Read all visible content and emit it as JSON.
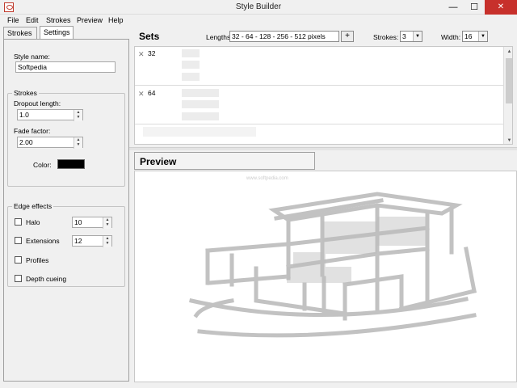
{
  "window": {
    "title": "Style Builder",
    "minimize": "—",
    "maximize": "☐",
    "close": "✕"
  },
  "menu": [
    "File",
    "Edit",
    "Strokes",
    "Preview",
    "Help"
  ],
  "tabs": {
    "strokes": "Strokes",
    "settings": "Settings"
  },
  "style_name": {
    "label": "Style name:",
    "value": "Softpedia"
  },
  "strokes_group": {
    "title": "Strokes",
    "dropout_label": "Dropout length:",
    "dropout_value": "1.0",
    "fade_label": "Fade factor:",
    "fade_value": "2.00",
    "color_label": "Color:",
    "color_value": "#000000"
  },
  "edge_effects": {
    "title": "Edge effects",
    "halo_label": "Halo",
    "halo_value": "10",
    "extensions_label": "Extensions",
    "extensions_value": "12",
    "profiles_label": "Profiles",
    "depth_label": "Depth cueing"
  },
  "sets": {
    "title": "Sets",
    "lengths_label": "Lengths:",
    "lengths_value": "32 - 64 - 128 - 256 - 512 pixels",
    "plus": "+",
    "strokes_label": "Strokes:",
    "strokes_value": "3",
    "width_label": "Width:",
    "width_value": "16",
    "rows": [
      {
        "remove": "✕",
        "value": "32"
      },
      {
        "remove": "✕",
        "value": "64"
      }
    ]
  },
  "preview": {
    "title": "Preview",
    "watermark": "www.softpedia.com"
  }
}
